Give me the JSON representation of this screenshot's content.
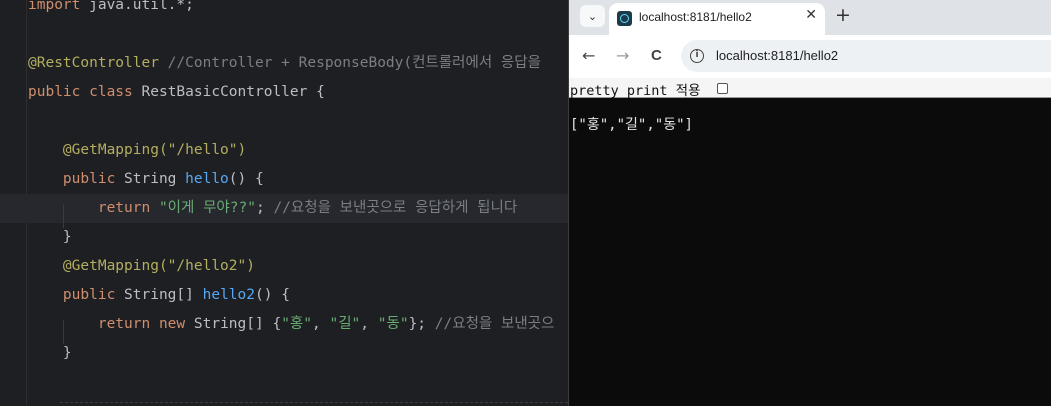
{
  "editor": {
    "lines": [
      {
        "tokens": [
          {
            "t": "import ",
            "c": "kw"
          },
          {
            "t": "java.util.*;",
            "c": "plain"
          }
        ]
      },
      {
        "tokens": []
      },
      {
        "tokens": [
          {
            "t": "@RestController",
            "c": "ann"
          },
          {
            "t": " //Controller + ResponseBody(컨트롤러에서 응답을",
            "c": "cmt"
          }
        ]
      },
      {
        "tokens": [
          {
            "t": "public class ",
            "c": "kw"
          },
          {
            "t": "RestBasicController {",
            "c": "plain"
          }
        ]
      },
      {
        "tokens": []
      },
      {
        "tokens": [
          {
            "t": "    @GetMapping(\"/hello\")",
            "c": "ann"
          }
        ]
      },
      {
        "tokens": [
          {
            "t": "    public ",
            "c": "kw"
          },
          {
            "t": "String ",
            "c": "plain"
          },
          {
            "t": "hello",
            "c": "fn"
          },
          {
            "t": "() {",
            "c": "plain"
          }
        ]
      },
      {
        "tokens": [
          {
            "t": "        return ",
            "c": "kw"
          },
          {
            "t": "\"이게 무야??\"",
            "c": "str"
          },
          {
            "t": "; ",
            "c": "plain"
          },
          {
            "t": "//요청을 보낸곳으로 응답하게 됩니다",
            "c": "cmt"
          }
        ]
      },
      {
        "tokens": [
          {
            "t": "    }",
            "c": "plain"
          }
        ]
      },
      {
        "tokens": [
          {
            "t": "    @GetMapping(\"/hello2\")",
            "c": "ann"
          }
        ]
      },
      {
        "tokens": [
          {
            "t": "    public ",
            "c": "kw"
          },
          {
            "t": "String[] ",
            "c": "plain"
          },
          {
            "t": "hello2",
            "c": "fn"
          },
          {
            "t": "() {",
            "c": "plain"
          }
        ]
      },
      {
        "tokens": [
          {
            "t": "        return new ",
            "c": "kw"
          },
          {
            "t": "String[] {",
            "c": "plain"
          },
          {
            "t": "\"홍\"",
            "c": "str"
          },
          {
            "t": ", ",
            "c": "plain"
          },
          {
            "t": "\"길\"",
            "c": "str"
          },
          {
            "t": ", ",
            "c": "plain"
          },
          {
            "t": "\"동\"",
            "c": "str"
          },
          {
            "t": "}; ",
            "c": "plain"
          },
          {
            "t": "//요청을 보낸곳으",
            "c": "cmt"
          }
        ]
      },
      {
        "tokens": [
          {
            "t": "    }",
            "c": "plain"
          }
        ]
      }
    ]
  },
  "browser": {
    "tab_title": "localhost:8181/hello2",
    "tab_close": "✕",
    "new_tab": "+",
    "menu_icon": "⌄",
    "back": "←",
    "forward": "→",
    "reload": "C",
    "info_icon": "i",
    "url": "localhost:8181/hello2",
    "pretty_print_label": "pretty print 적용",
    "pretty_print_checked": false,
    "response_body": "[\"홍\",\"길\",\"동\"]"
  }
}
